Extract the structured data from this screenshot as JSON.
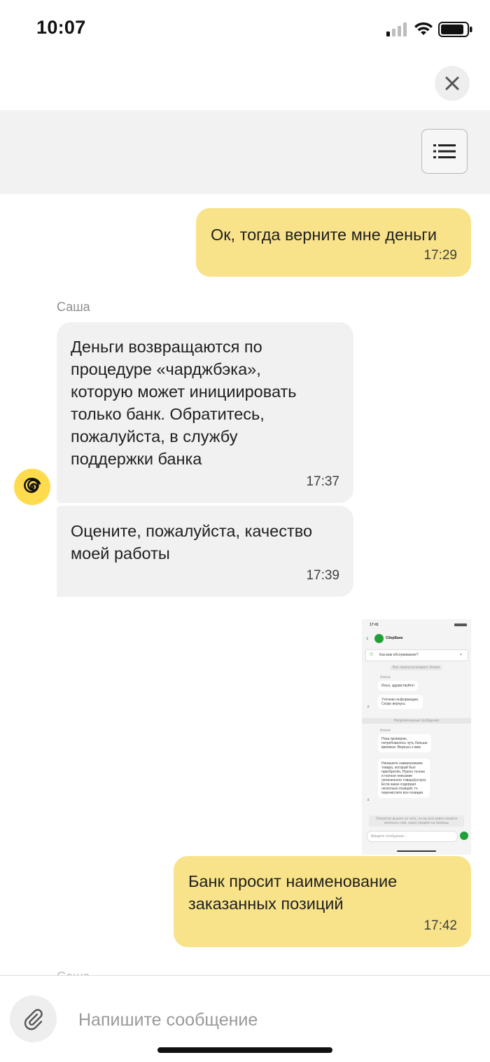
{
  "status_bar": {
    "time": "10:07"
  },
  "icons": {
    "close": "close-icon",
    "menu": "list-menu-icon",
    "attach": "paperclip-icon",
    "avatar": "spiral-logo-icon"
  },
  "colors": {
    "outgoing_bubble": "#f8e38a",
    "incoming_bubble": "#f1f1f1",
    "avatar": "#ffdb4d"
  },
  "chat": {
    "messages": [
      {
        "direction": "out",
        "text": "Ок, тогда верните мне деньги",
        "time": "17:29"
      },
      {
        "direction": "in",
        "sender": "Саша",
        "text": "Деньги возвращаются по\nпроцедуре «чарджбэка»,\nкоторую может инициировать\nтолько банк. Обратитесь,\nпожалуйста, в службу\nподдержки банка",
        "time": "17:37"
      },
      {
        "direction": "in",
        "text": "Оцените, пожалуйста, качество\nмоей работы",
        "time": "17:39"
      },
      {
        "direction": "out",
        "type": "image"
      },
      {
        "direction": "out",
        "text": "Банк просит наименование\nзаказанных позиций",
        "time": "17:42"
      }
    ],
    "next_sender": "Саша"
  },
  "attachment_screenshot": {
    "time": "17:41",
    "title": "СберБанк",
    "rating_prompt": "Как вам обслуживание?",
    "system_note": "Вас проконсультирует Алина",
    "agent_name": "Алина",
    "messages": [
      "Илья, здравствуйте!",
      "Уточняю информацию.\nСкоро вернусь",
      "Пока проверяю,\nпотребовалось чуть больше\nвремени. Вернусь к вам",
      "Напишите наименование\nтовара, который был\nприобретён. Нужно точное\nи полное описание\nоплаченного товара/услуги.\nЕсли заказ содержал\nнесколько позиций, то\nперечислите все позиции"
    ],
    "unread_divider": "Непрочитанные сообщения",
    "footer_note": "Оператор вышел из чата, но вы всё равно можете\nнаписать нам, сразу придём на помощь",
    "input_placeholder": "Введите сообщение..."
  },
  "composer": {
    "placeholder": "Напишите сообщение"
  }
}
